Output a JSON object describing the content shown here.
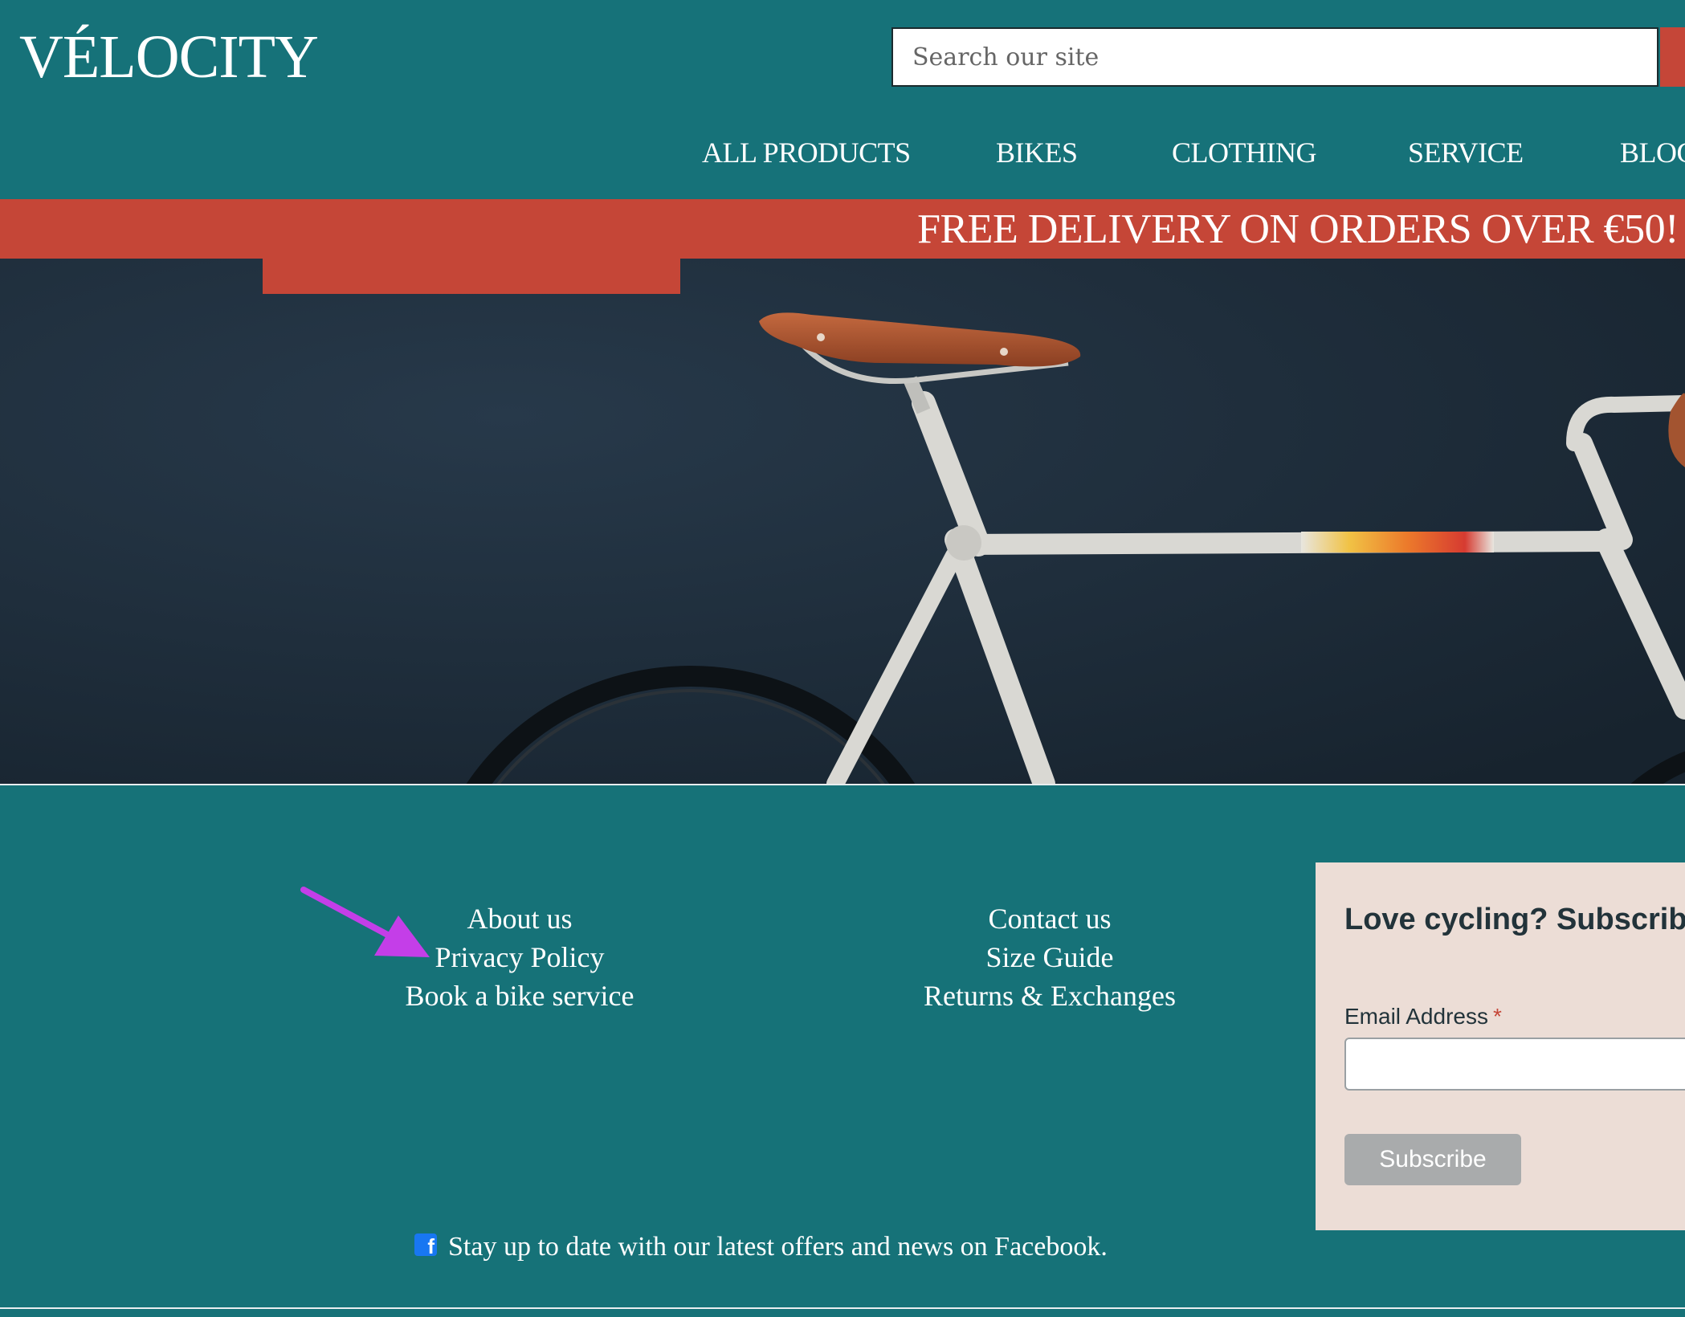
{
  "brand": {
    "logo_text": "VÉLOCITY"
  },
  "search": {
    "placeholder": "Search our site"
  },
  "nav": {
    "items": [
      {
        "label": "ALL PRODUCTS"
      },
      {
        "label": "BIKES"
      },
      {
        "label": "CLOTHING"
      },
      {
        "label": "SERVICE"
      },
      {
        "label": "BLOG"
      }
    ]
  },
  "promo": {
    "text": "FREE DELIVERY ON ORDERS OVER €50!"
  },
  "hero": {
    "image_subject": "vintage white road bike with brown leather saddle against dark wall"
  },
  "footer": {
    "column_1": [
      {
        "label": "About us"
      },
      {
        "label": "Privacy Policy"
      },
      {
        "label": "Book a bike service"
      }
    ],
    "column_2": [
      {
        "label": "Contact us"
      },
      {
        "label": "Size Guide"
      },
      {
        "label": "Returns & Exchanges"
      }
    ],
    "facebook": {
      "icon": "facebook-icon",
      "text": "Stay up to date with our latest offers and news on Facebook."
    }
  },
  "subscribe": {
    "heading": "Love cycling? Subscribe",
    "email_label": "Email Address",
    "required_mark": "*",
    "button_label": "Subscribe"
  },
  "annotation": {
    "icon": "arrow-icon",
    "color": "#c43ee8"
  },
  "colors": {
    "teal": "#167279",
    "promo_red": "#c54637",
    "card_bg": "#ecddd6",
    "button_grey": "#a9abac",
    "hero_bg": "#1b2a36"
  }
}
